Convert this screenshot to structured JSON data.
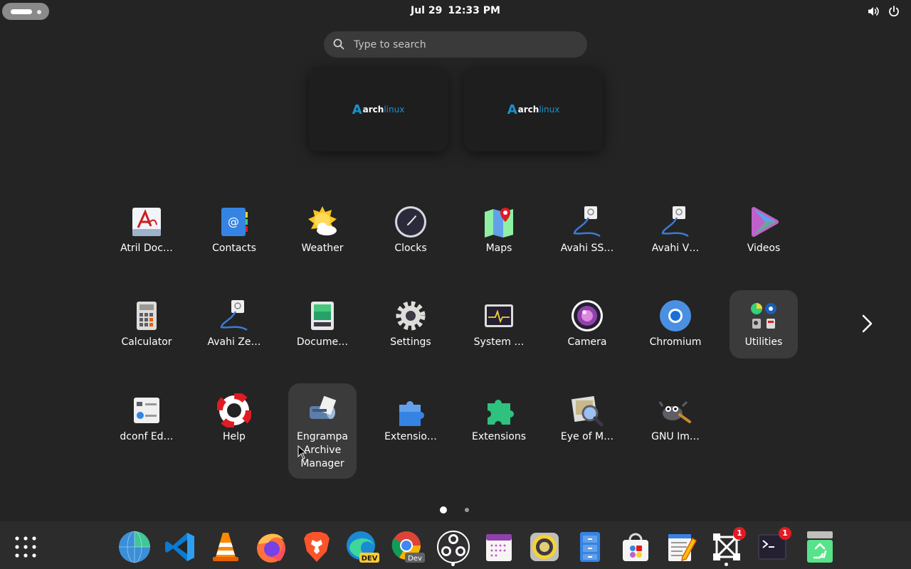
{
  "topbar": {
    "date": "Jul 29",
    "time": "12:33 PM",
    "tray": [
      "volume-icon",
      "power-icon"
    ]
  },
  "search": {
    "placeholder": "Type to search"
  },
  "workspaces": [
    {
      "logo_a": "A",
      "logo_arch": "arch",
      "logo_linux": "linux"
    },
    {
      "logo_a": "A",
      "logo_arch": "arch",
      "logo_linux": "linux"
    }
  ],
  "apps": [
    {
      "label": "Atril Doc…",
      "icon": "atril-icon"
    },
    {
      "label": "Contacts",
      "icon": "contacts-icon"
    },
    {
      "label": "Weather",
      "icon": "weather-icon"
    },
    {
      "label": "Clocks",
      "icon": "clocks-icon"
    },
    {
      "label": "Maps",
      "icon": "maps-icon"
    },
    {
      "label": "Avahi SS…",
      "icon": "avahi-ssh-icon"
    },
    {
      "label": "Avahi V…",
      "icon": "avahi-vnc-icon"
    },
    {
      "label": "Videos",
      "icon": "videos-icon"
    },
    {
      "label": "Calculator",
      "icon": "calculator-icon"
    },
    {
      "label": "Avahi Ze…",
      "icon": "avahi-zeroconf-icon"
    },
    {
      "label": "Docume…",
      "icon": "document-scanner-icon"
    },
    {
      "label": "Settings",
      "icon": "settings-icon"
    },
    {
      "label": "System …",
      "icon": "system-monitor-icon"
    },
    {
      "label": "Camera",
      "icon": "camera-icon"
    },
    {
      "label": "Chromium",
      "icon": "chromium-icon"
    },
    {
      "label": "Utilities",
      "icon": "utilities-folder-icon"
    },
    {
      "label": "dconf Ed…",
      "icon": "dconf-editor-icon"
    },
    {
      "label": "Help",
      "icon": "help-icon"
    },
    {
      "label": "Engrampa Archive Manager",
      "label_lines": [
        "Engrampa",
        "Archive",
        "Manager"
      ],
      "icon": "engrampa-icon"
    },
    {
      "label": "Extensio…",
      "icon": "extension-manager-icon"
    },
    {
      "label": "Extensions",
      "icon": "extensions-icon"
    },
    {
      "label": "Eye of M…",
      "icon": "eye-of-mate-icon"
    },
    {
      "label": "GNU Im…",
      "icon": "gimp-icon"
    }
  ],
  "pages": {
    "count": 2,
    "current": 1
  },
  "dash": {
    "apps": [
      {
        "name": "show-apps-icon"
      },
      {
        "name": "globe-browser-icon"
      },
      {
        "name": "vscode-icon"
      },
      {
        "name": "vlc-icon"
      },
      {
        "name": "firefox-icon"
      },
      {
        "name": "brave-icon"
      },
      {
        "name": "edge-dev-icon",
        "tag": "DEV"
      },
      {
        "name": "chrome-dev-icon",
        "tag": "Dev"
      },
      {
        "name": "obs-icon"
      },
      {
        "name": "calendar-icon"
      },
      {
        "name": "speaker-icon"
      },
      {
        "name": "file-cabinet-icon"
      },
      {
        "name": "software-store-icon"
      },
      {
        "name": "text-editor-icon"
      },
      {
        "name": "screenshot-tool-icon",
        "badge": "1"
      },
      {
        "name": "terminal-icon",
        "badge": "1"
      },
      {
        "name": "trash-icon"
      }
    ]
  },
  "colors": {
    "background": "#242424",
    "dash": "#2c2c2c",
    "search": "#3a3a3a",
    "highlight": "#3b3b3b",
    "badge": "#e01b24",
    "arch_blue": "#1793d1"
  }
}
